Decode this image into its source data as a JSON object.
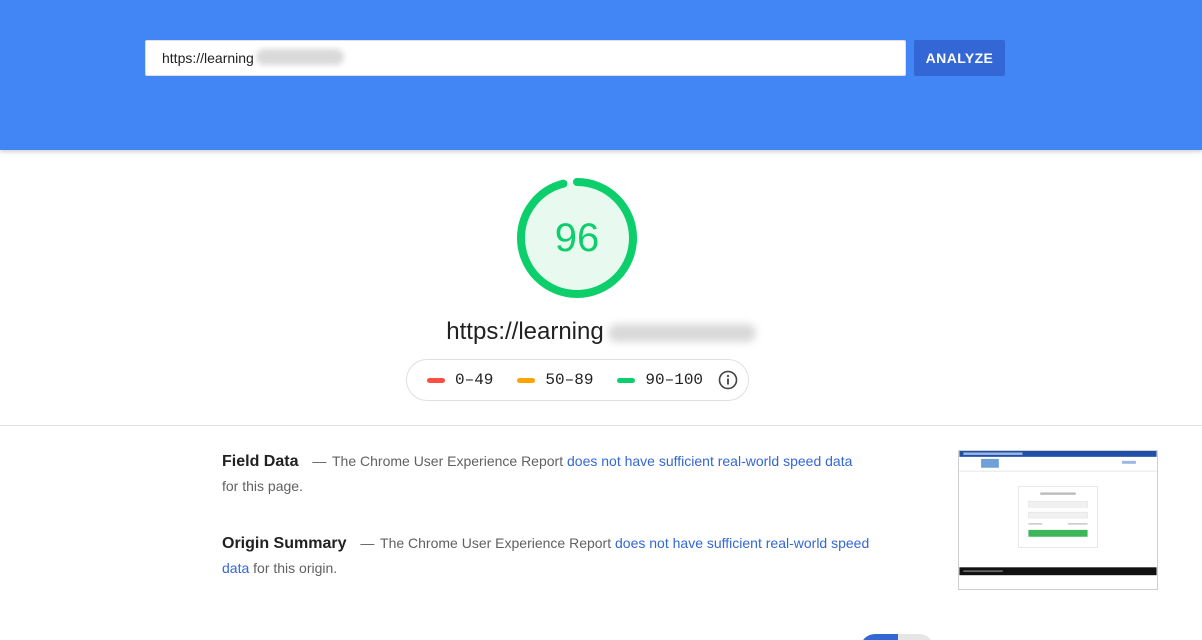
{
  "header": {
    "url_value": "https://learning",
    "analyze_label": "ANALYZE"
  },
  "score": {
    "value": "96",
    "fraction": 0.96,
    "color": "#0cce6b",
    "fill_color": "#e8faf0"
  },
  "page_url": "https://learning",
  "legend": {
    "items": [
      {
        "label": "0–49",
        "color": "#ff4e42"
      },
      {
        "label": "50–89",
        "color": "#ffa400"
      },
      {
        "label": "90–100",
        "color": "#0cce6b"
      }
    ],
    "info_icon": "info-icon"
  },
  "field_data": {
    "title": "Field Data",
    "dash": "—",
    "text_before": "The Chrome User Experience Report",
    "link": "does not have sufficient real-world speed data",
    "text_after": "for this page."
  },
  "origin_summary": {
    "title": "Origin Summary",
    "dash": "—",
    "text_before": "The Chrome User Experience Report",
    "link": "does not have sufficient real-world speed data",
    "text_after": "for this origin."
  },
  "colors": {
    "header_bg": "#4285f4",
    "button_bg": "#3367d6",
    "link": "#3367d6"
  }
}
